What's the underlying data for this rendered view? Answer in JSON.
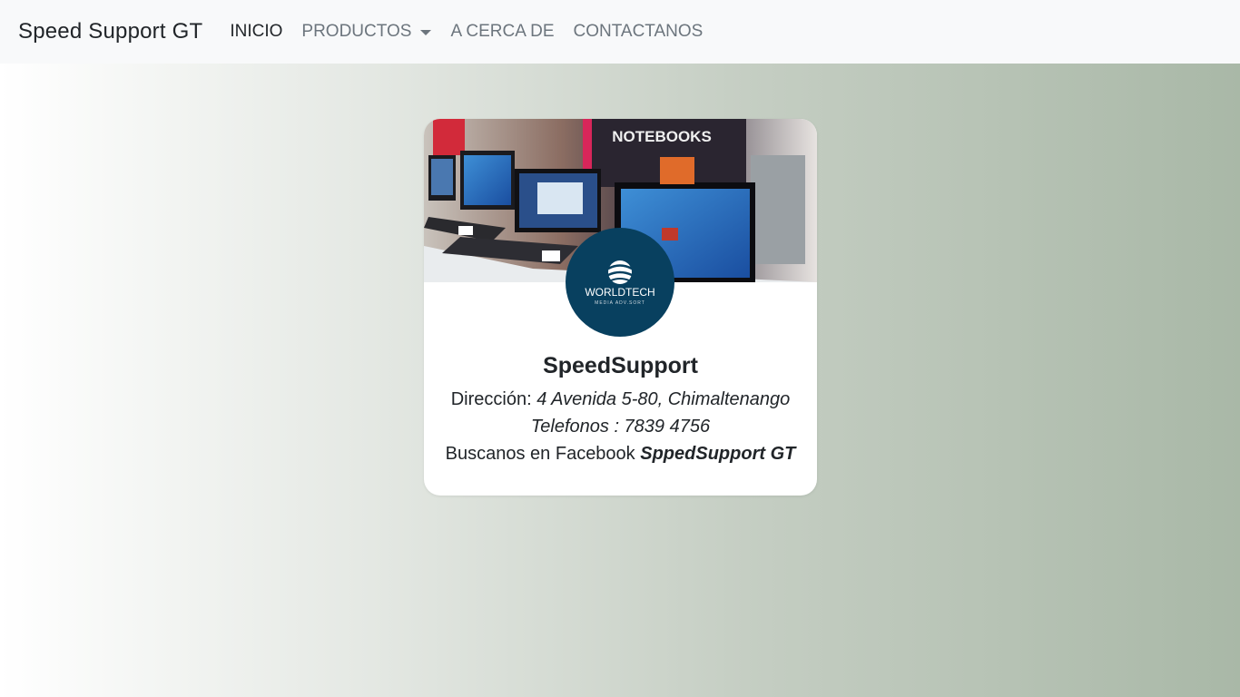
{
  "navbar": {
    "brand": "Speed Support GT",
    "links": [
      {
        "label": "INICIO"
      },
      {
        "label": "PRODUCTOS"
      },
      {
        "label": "A CERCA DE"
      },
      {
        "label": "CONTACTANOS"
      }
    ]
  },
  "card": {
    "cover_sign": "NOTEBOOKS",
    "logo_title": "WORLDTECH",
    "logo_subtitle": "MEDIA ADV.SORT",
    "title": "SpeedSupport",
    "address_label": "Dirección:",
    "address_value": "4 Avenida 5-80, Chimaltenango",
    "phone_text": "Telefonos : 7839 4756",
    "facebook_label": "Buscanos en Facebook",
    "facebook_value": "SppedSupport GT"
  },
  "colors": {
    "navbar_bg": "#f8f9fa",
    "logo_bg": "#08405f"
  }
}
